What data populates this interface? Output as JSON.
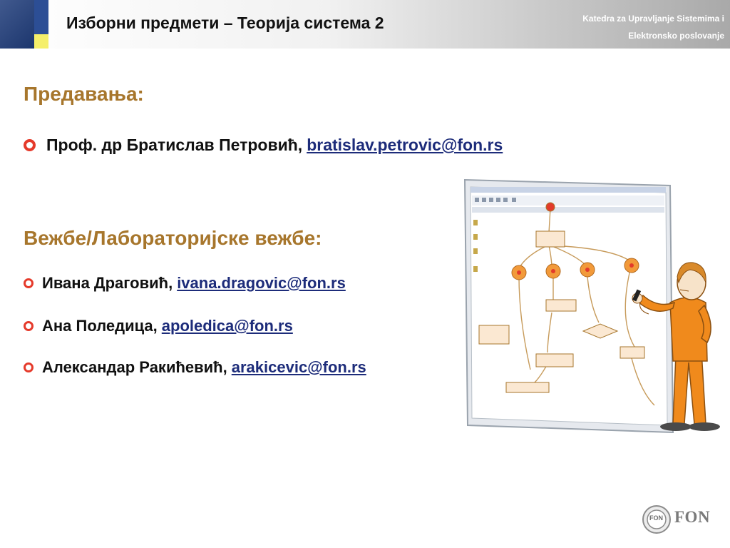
{
  "header": {
    "title": "Изборни предмети – Теорија система 2",
    "dept_line1": "Katedra za Upravljanje Sistemima i",
    "dept_line2": "Elektronsko poslovanje"
  },
  "lectures": {
    "heading": "Предавања:",
    "items": [
      {
        "name": "Проф. др Братислав Петровић, ",
        "email": "bratislav.petrovic@fon.rs"
      }
    ]
  },
  "exercises": {
    "heading": "Вежбе/Лабораторијске вежбе:",
    "items": [
      {
        "name": "Ивана Драговић, ",
        "email": "ivana.dragovic@fon.rs"
      },
      {
        "name": "Ана Поледица, ",
        "email": "apoledica@fon.rs"
      },
      {
        "name": "Александар Ракићевић, ",
        "email": "arakicevic@fon.rs"
      }
    ]
  },
  "footer": {
    "logo_text": "FON",
    "logo_badge": "FON"
  },
  "colors": {
    "heading": "#a7762c",
    "bullet": "#e53a2b",
    "link": "#1d2c7a",
    "header_dark_blue": "#1f3c7a",
    "header_yellow": "#f5ef6a"
  },
  "icons": {
    "bullet": "hollow-circle-bullet-icon",
    "illustration": "person-drawing-flowchart-illustration",
    "logo": "fon-seal-icon"
  }
}
